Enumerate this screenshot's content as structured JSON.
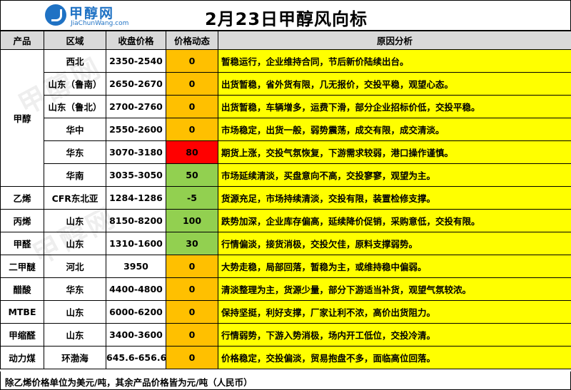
{
  "header": {
    "title": "2月23日甲醇风向标",
    "logo_cn": "甲醇网",
    "logo_en": "JiaChunWang.com"
  },
  "columns": [
    "产品",
    "区域",
    "收盘价格",
    "价格动态",
    "原因分析"
  ],
  "rows": [
    {
      "product": "甲醇",
      "region": "西北",
      "price": "2350-2540",
      "change": "0",
      "trend": "flat",
      "reason": "暂稳运行，企业维持合同，节后新价陆续出台。"
    },
    {
      "product": "",
      "region": "山东（鲁南）",
      "price": "2650-2670",
      "change": "0",
      "trend": "flat",
      "reason": "出货暂稳，省外货有限，几无报价，交投平稳，观望心态。"
    },
    {
      "product": "",
      "region": "山东（鲁北）",
      "price": "2700-2760",
      "change": "0",
      "trend": "flat",
      "reason": "出货暂稳，车辆增多，运费下滑，部分企业招标价低，交投平稳。"
    },
    {
      "product": "",
      "region": "华中",
      "price": "2550-2600",
      "change": "0",
      "trend": "flat",
      "reason": "市场稳定，出货一般，弱势震荡，成交有限，成交清淡。"
    },
    {
      "product": "",
      "region": "华东",
      "price": "3070-3180",
      "change": "80",
      "trend": "up-strong",
      "reason": "期货上涨，交投气氛恢复，下游需求较弱，港口操作谨慎。"
    },
    {
      "product": "",
      "region": "华南",
      "price": "3035-3050",
      "change": "50",
      "trend": "up",
      "reason": "市场延续清淡，买盘意向不高，交投寥寥，观望为主。"
    },
    {
      "product": "乙烯",
      "region": "CFR东北亚",
      "price": "1284-1286",
      "change": "-5",
      "trend": "down",
      "reason": "货源充足，市场持续清淡，交投有限，装置检修支撑。"
    },
    {
      "product": "丙烯",
      "region": "山东",
      "price": "8150-8200",
      "change": "100",
      "trend": "up",
      "reason": "跌势加深，企业库存偏高，延续降价促销，采购意低，交投有限。"
    },
    {
      "product": "甲醛",
      "region": "山东",
      "price": "1310-1600",
      "change": "30",
      "trend": "up",
      "reason": "行情偏淡，接货消极，交投欠佳，原料支撑弱势。"
    },
    {
      "product": "二甲醚",
      "region": "河北",
      "price": "3950",
      "change": "0",
      "trend": "flat",
      "reason": "大势走稳，局部回落，暂稳为主，或维持稳中偏弱。"
    },
    {
      "product": "醋酸",
      "region": "华东",
      "price": "4400-4800",
      "change": "0",
      "trend": "flat",
      "reason": "清淡整理为主，货源少量，部分下游适当补货，观望气氛较浓。"
    },
    {
      "product": "MTBE",
      "region": "山东",
      "price": "6000-6200",
      "change": "0",
      "trend": "flat",
      "reason": "保持坚挺，利好支撑，厂家让利不浓，高价出货阻力。"
    },
    {
      "product": "甲缩醛",
      "region": "山东",
      "price": "3400-3600",
      "change": "0",
      "trend": "flat",
      "reason": "行情弱势，下游入势消极，场内开工低位，交投冷清。"
    },
    {
      "product": "动力煤",
      "region": "环渤海",
      "price": "645.6-656.6",
      "change": "0",
      "trend": "flat",
      "reason": "价格稳定，交投偏淡，贸易抱盘不多，面临高位回落。"
    }
  ],
  "footnote": "除乙烯价格单位为美元/吨，其余产品价格皆为元/吨（人民币）",
  "colors": {
    "header_bg": "#d9d9d9",
    "reason_bg": "#ffff00",
    "flat": "#ffc000",
    "up_strong": "#ff0000",
    "up": "#92d050",
    "down": "#92d050",
    "brand": "#1f72c4"
  }
}
